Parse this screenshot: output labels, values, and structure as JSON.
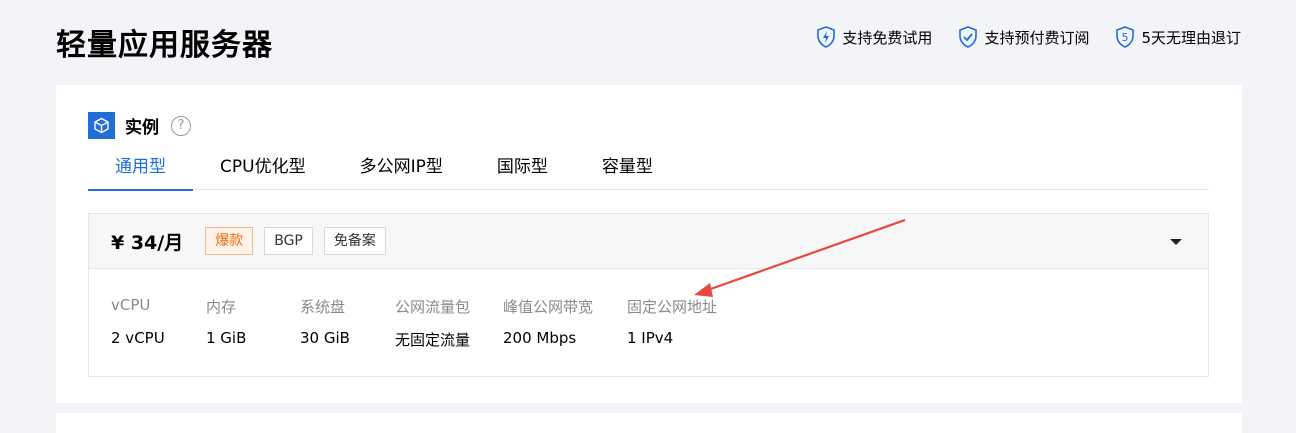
{
  "page": {
    "title": "轻量应用服务器"
  },
  "features": [
    {
      "icon": "lightning-shield-icon",
      "label": "支持免费试用"
    },
    {
      "icon": "check-shield-icon",
      "label": "支持预付费订阅"
    },
    {
      "icon": "five-shield-icon",
      "label": "5天无理由退订",
      "glyph": "5"
    }
  ],
  "section": {
    "title": "实例",
    "icon": "cube-icon",
    "help": "?"
  },
  "tabs": [
    {
      "label": "通用型",
      "active": true
    },
    {
      "label": "CPU优化型",
      "active": false
    },
    {
      "label": "多公网IP型",
      "active": false
    },
    {
      "label": "国际型",
      "active": false
    },
    {
      "label": "容量型",
      "active": false
    }
  ],
  "plan": {
    "price": "¥ 34/月",
    "tags": [
      "爆款",
      "BGP",
      "免备案"
    ],
    "specs": [
      {
        "label": "vCPU",
        "value": "2 vCPU"
      },
      {
        "label": "内存",
        "value": "1 GiB"
      },
      {
        "label": "系统盘",
        "value": "30 GiB"
      },
      {
        "label": "公网流量包",
        "value": "无固定流量"
      },
      {
        "label": "峰值公网带宽",
        "value": "200 Mbps"
      },
      {
        "label": "固定公网地址",
        "value": "1 IPv4"
      }
    ]
  },
  "colors": {
    "accent": "#1f6fd6",
    "hot_tag": "#ed6a0c",
    "annotation_arrow": "#e8473f"
  }
}
